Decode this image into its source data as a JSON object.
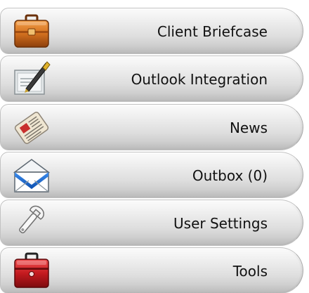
{
  "menu": {
    "items": [
      {
        "label": "Client Briefcase",
        "icon": "briefcase-icon"
      },
      {
        "label": "Outlook Integration",
        "icon": "outlook-integration-icon"
      },
      {
        "label": "News",
        "icon": "newspaper-icon"
      },
      {
        "label": "Outbox (0)",
        "icon": "envelope-icon"
      },
      {
        "label": "User Settings",
        "icon": "wrench-icon"
      },
      {
        "label": "Tools",
        "icon": "toolbox-icon"
      }
    ]
  },
  "colors": {
    "button_light": "#fbfbfb",
    "button_dark": "#b9b9b9",
    "text": "#111111",
    "briefcase": "#c8681a",
    "toolbox": "#c41a1f",
    "envelope_blue": "#1a63c9"
  }
}
